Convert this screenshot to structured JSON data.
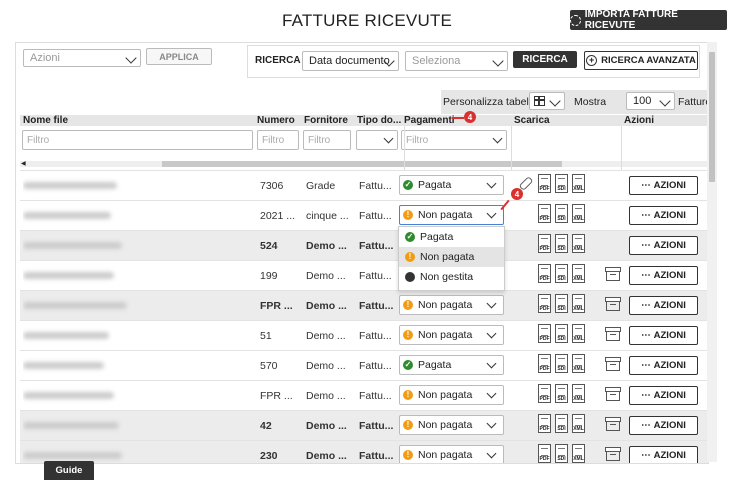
{
  "page": {
    "title": "FATTURE RICEVUTE",
    "import_button": "IMPORTA FATTURE RICEVUTE"
  },
  "toolbar": {
    "actions_placeholder": "Azioni",
    "apply_label": "APPLICA",
    "search_label": "RICERCA",
    "search_field_value": "Data documento",
    "search_value_placeholder": "Seleziona",
    "search_button": "RICERCA",
    "advanced_search_button": "RICERCA AVANZATA",
    "customize_label": "Personalizza tabella",
    "show_label": "Mostra",
    "page_size": "100",
    "page_size_suffix": "Fatture"
  },
  "table": {
    "columns": [
      "Nome file",
      "Numero",
      "Fornitore",
      "Tipo do...",
      "Pagamenti",
      "Scarica",
      "Azioni"
    ],
    "filter_placeholder": "Filtro",
    "download_labels": [
      "PDF",
      "SDI",
      "XML"
    ],
    "action_label": "AZIONI",
    "rows": [
      {
        "numero": "7306",
        "fornitore": "Grade",
        "tipo": "Fattu...",
        "pagamento": "Pagata",
        "status": "green",
        "bold": false,
        "archive": false
      },
      {
        "numero": "2021 ...",
        "fornitore": "cinque ...",
        "tipo": "Fattu...",
        "pagamento": "Non pagata",
        "status": "orange",
        "bold": false,
        "archive": false
      },
      {
        "numero": "524",
        "fornitore": "Demo ...",
        "tipo": "Fattu...",
        "pagamento": "",
        "status": "",
        "bold": true,
        "archive": false
      },
      {
        "numero": "199",
        "fornitore": "Demo ...",
        "tipo": "Fattu...",
        "pagamento": "",
        "status": "",
        "bold": false,
        "archive": true
      },
      {
        "numero": "FPR ...",
        "fornitore": "Demo ...",
        "tipo": "Fattu...",
        "pagamento": "Non pagata",
        "status": "orange",
        "bold": true,
        "archive": true
      },
      {
        "numero": "51",
        "fornitore": "Demo ...",
        "tipo": "Fattu...",
        "pagamento": "Non pagata",
        "status": "orange",
        "bold": false,
        "archive": true
      },
      {
        "numero": "570",
        "fornitore": "Demo ...",
        "tipo": "Fattu...",
        "pagamento": "Pagata",
        "status": "green",
        "bold": false,
        "archive": true
      },
      {
        "numero": "FPR ...",
        "fornitore": "Demo ...",
        "tipo": "Fattu...",
        "pagamento": "Non pagata",
        "status": "orange",
        "bold": false,
        "archive": true
      },
      {
        "numero": "42",
        "fornitore": "Demo ...",
        "tipo": "Fattu...",
        "pagamento": "Non pagata",
        "status": "orange",
        "bold": true,
        "archive": true
      },
      {
        "numero": "230",
        "fornitore": "Demo ...",
        "tipo": "Fattu...",
        "pagamento": "Non pagata",
        "status": "orange",
        "bold": true,
        "archive": true
      }
    ]
  },
  "dropdown": {
    "options": [
      "Pagata",
      "Non pagata",
      "Non gestita"
    ],
    "highlighted": "Non pagata"
  },
  "annotations": {
    "badge_number": "4"
  },
  "footer": {
    "guide_button": "Guide"
  },
  "colors": {
    "paid": "#2e8b2e",
    "unpaid": "#f39c12",
    "unmanaged": "#333333",
    "badge": "#d93030"
  }
}
